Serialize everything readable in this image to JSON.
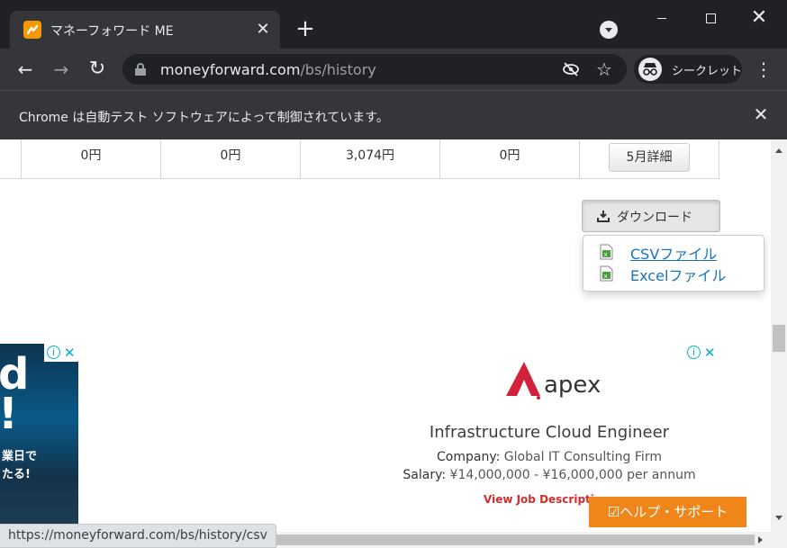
{
  "browser": {
    "tab_title": "マネーフォワード ME",
    "url_domain": "moneyforward.com",
    "url_path": "/bs/history",
    "incognito_label": "シークレット",
    "infobar_text": "Chrome は自動テスト ソフトウェアによって制御されています。",
    "status_url": "https://moneyforward.com/bs/history/csv"
  },
  "table": {
    "row": [
      "0円",
      "0円",
      "3,074円",
      "0円"
    ],
    "detail_button": "5月詳細"
  },
  "download": {
    "button_label": "ダウンロード",
    "menu": [
      {
        "label": "CSVファイル",
        "icon": "excel-file-icon"
      },
      {
        "label": "Excelファイル",
        "icon": "excel-file-icon"
      }
    ]
  },
  "ads": {
    "left_big": "d\n!",
    "left_small": "業日で\nたる!",
    "main": {
      "logo_text": "apex",
      "title": "Infrastructure Cloud Engineer",
      "company_label": "Company:",
      "company_value": "Global IT Consulting Firm",
      "salary_label": "Salary:",
      "salary_value": "¥14,000,000 - ¥16,000,000 per annum",
      "cta": "View Job Description"
    }
  },
  "help_button": "ヘルプ・サポート",
  "colors": {
    "brand_orange": "#f08519",
    "link_blue": "#1a73b8",
    "chrome_dark": "#202124",
    "apex_red": "#d3213a"
  }
}
